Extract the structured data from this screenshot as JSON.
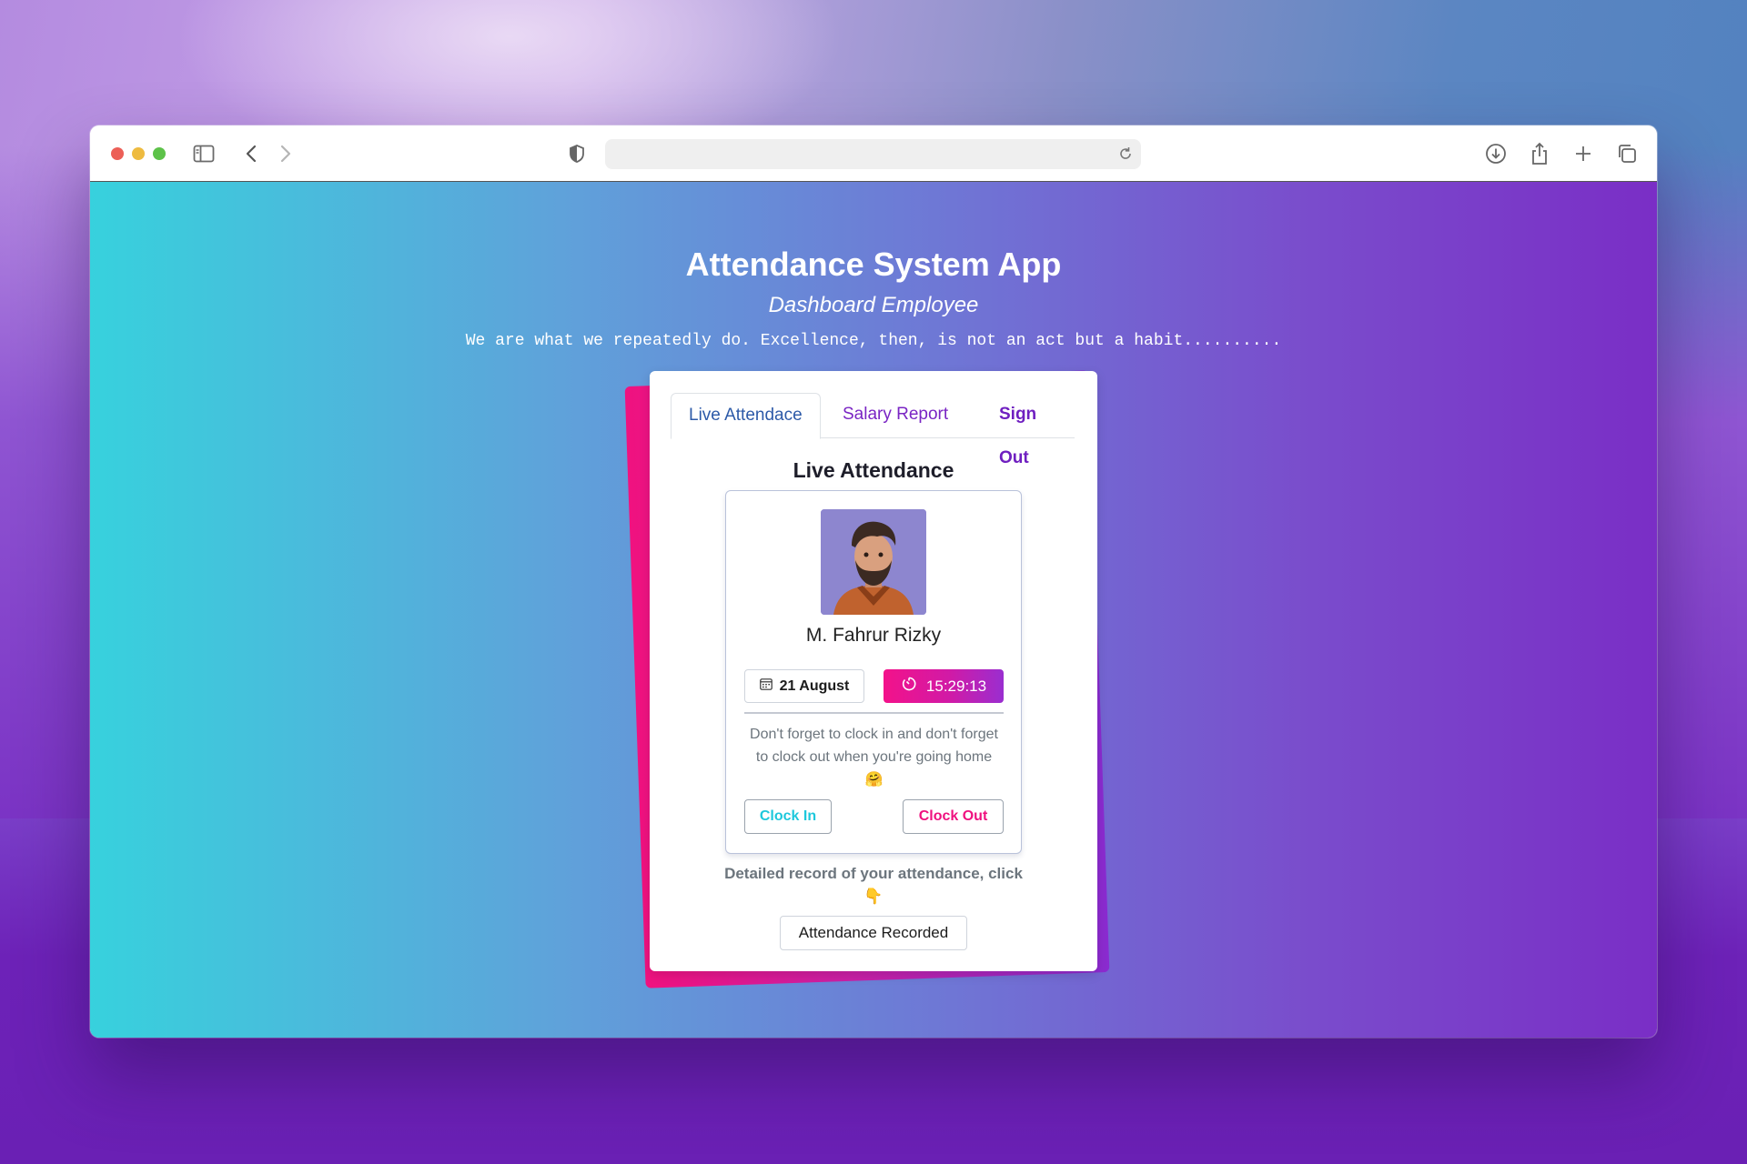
{
  "app": {
    "title": "Attendance System App",
    "subtitle": "Dashboard Employee",
    "quote": "We are what we repeatedly do. Excellence, then, is not an act but a habit.........."
  },
  "tabs": [
    {
      "label": "Live Attendace",
      "active": true
    },
    {
      "label": "Salary Report",
      "active": false
    },
    {
      "label": "Sign Out",
      "active": false
    }
  ],
  "panel": {
    "title": "Live Attendance",
    "employee_name": "M. Fahrur Rizky",
    "date": "21 August",
    "time": "15:29:13",
    "reminder": "Don't forget to clock in and don't forget to clock out when you're going home🤗",
    "clock_in_label": "Clock In",
    "clock_out_label": "Clock Out",
    "record_text": "Detailed record of your attendance, click👇",
    "recorded_button_label": "Attendance Recorded"
  },
  "colors": {
    "accent_pink": "#f3128a",
    "accent_cyan": "#1ec8dc",
    "accent_purple": "#7a25c4"
  },
  "icons": {
    "date": "calendar-icon",
    "time": "stopwatch-icon"
  }
}
